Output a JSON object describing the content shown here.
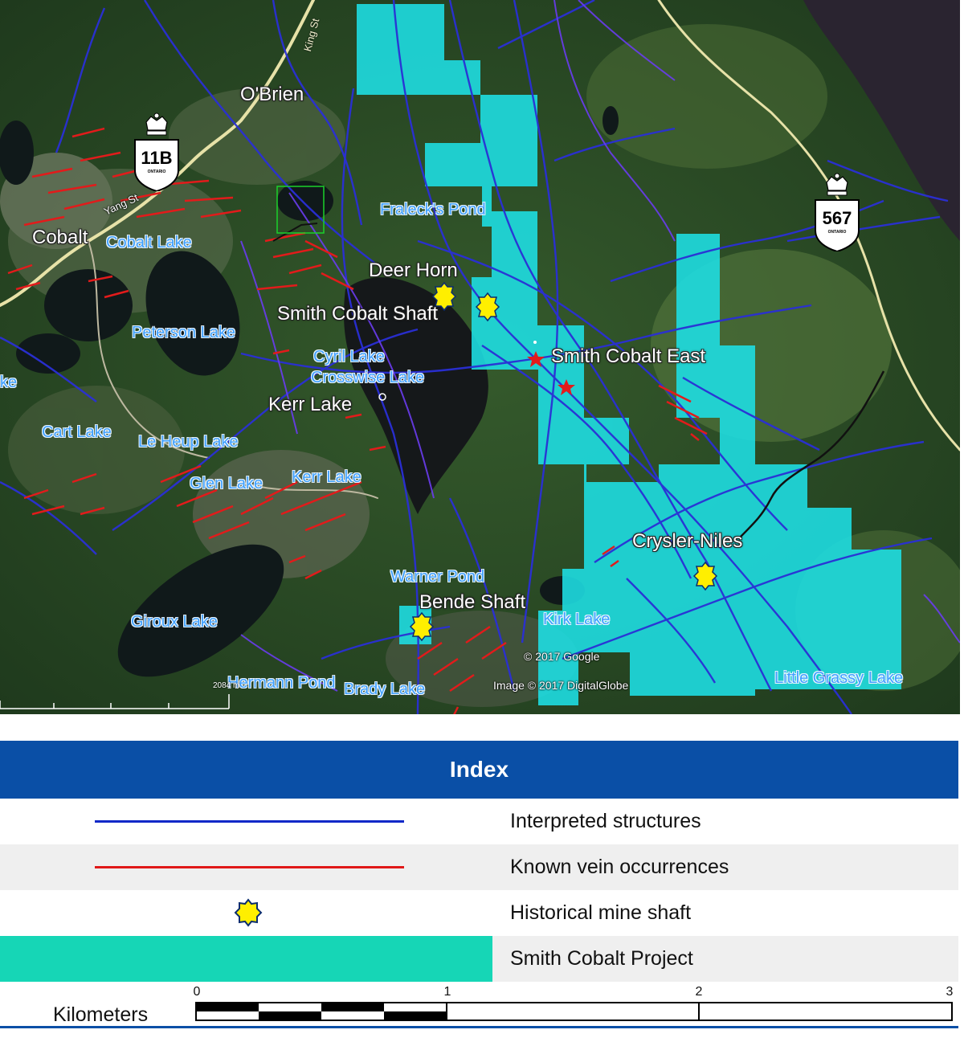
{
  "map": {
    "places": {
      "obrien": "O'Brien",
      "cobalt": "Cobalt",
      "deer_horn": "Deer Horn",
      "smith_cobalt_shaft": "Smith Cobalt Shaft",
      "smith_cobalt_east": "Smith Cobalt East",
      "kerr_lake_town": "Kerr Lake",
      "crysler_niles": "Crysler-Niles",
      "bende_shaft": "Bende Shaft"
    },
    "water": {
      "cobalt_lake": "Cobalt Lake",
      "fralecks_pond": "Fraleck's Pond",
      "peterson_lake": "Peterson Lake",
      "cyril_lake": "Cyril Lake",
      "crosswise_lake": "Crosswise Lake",
      "lake_edge": "ke",
      "cart_lake": "Cart Lake",
      "le_heup_lake": "Le Heup Lake",
      "glen_lake": "Glen Lake",
      "kerr_lake": "Kerr Lake",
      "warner_pond": "Warner Pond",
      "kirk_lake": "Kirk Lake",
      "giroux_lake": "Giroux Lake",
      "hermann_pond": "Hermann Pond",
      "brady_lake": "Brady Lake",
      "little_grassy_lake": "Little Grassy Lake"
    },
    "roads": {
      "king_st": "King St",
      "yang_st": "Yang St"
    },
    "highways": [
      {
        "number": "11B",
        "province": "ONTARIO"
      },
      {
        "number": "567",
        "province": "ONTARIO"
      }
    ],
    "attribution": {
      "copyright": "© 2017 Google",
      "imagery": "Image © 2017 DigitalGlobe",
      "scale_text": "2084 m"
    }
  },
  "legend": {
    "title": "Index",
    "items": [
      {
        "label": "Interpreted structures",
        "symbol": "line",
        "color": "#1028c8"
      },
      {
        "label": "Known vein occurrences",
        "symbol": "line",
        "color": "#e01818"
      },
      {
        "label": "Historical mine shaft",
        "symbol": "star",
        "color": "#ffef00"
      },
      {
        "label": "Smith Cobalt Project",
        "symbol": "fill",
        "color": "#16d6b6"
      }
    ]
  },
  "scale": {
    "unit_label": "Kilometers",
    "ticks": [
      "0",
      "1",
      "2",
      "3"
    ]
  },
  "colors": {
    "header": "#0a4fa6",
    "claims": "#1ee0e6",
    "structures": "#1028c8",
    "veins": "#e01818",
    "shaft": "#ffef00"
  }
}
